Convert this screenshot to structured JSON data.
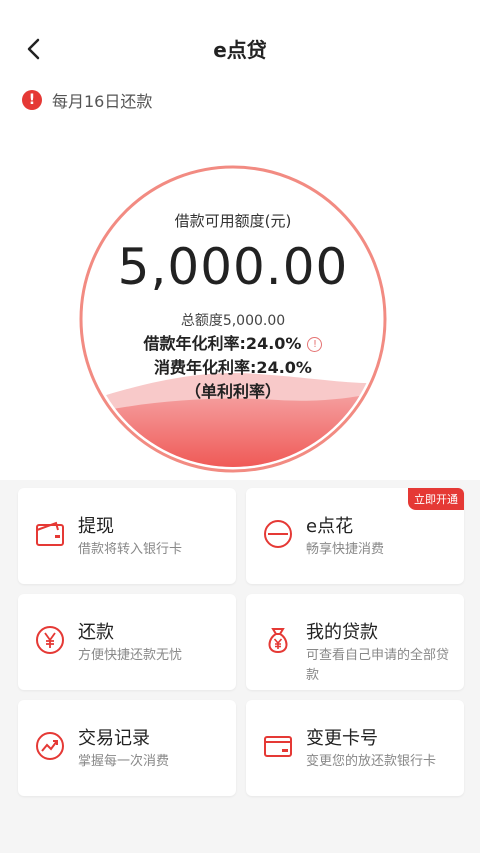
{
  "header": {
    "title": "e点贷"
  },
  "notice": {
    "text": "每月16日还款"
  },
  "circle": {
    "label": "借款可用额度(元)",
    "amount": "5,000.00",
    "total": "总额度5,000.00",
    "borrow_rate": "借款年化利率:24.0%",
    "consume_rate": "消费年化利率:24.0%",
    "simple_rate": "（单利利率）",
    "accent": "#e53935",
    "wave_fill_fraction": 0.2
  },
  "cards": [
    {
      "title": "提现",
      "subtitle": "借款将转入银行卡",
      "icon": "wallet-icon"
    },
    {
      "title": "e点花",
      "subtitle": "畅享快捷消费",
      "icon": "minus-circle-icon",
      "badge": "立即开通"
    },
    {
      "title": "还款",
      "subtitle": "方便快捷还款无忧",
      "icon": "yen-circle-icon"
    },
    {
      "title": "我的贷款",
      "subtitle": "可查看自己申请的全部贷款",
      "icon": "money-bag-icon"
    },
    {
      "title": "交易记录",
      "subtitle": "掌握每一次消费",
      "icon": "trend-icon"
    },
    {
      "title": "变更卡号",
      "subtitle": "变更您的放还款银行卡",
      "icon": "bank-card-icon"
    }
  ]
}
